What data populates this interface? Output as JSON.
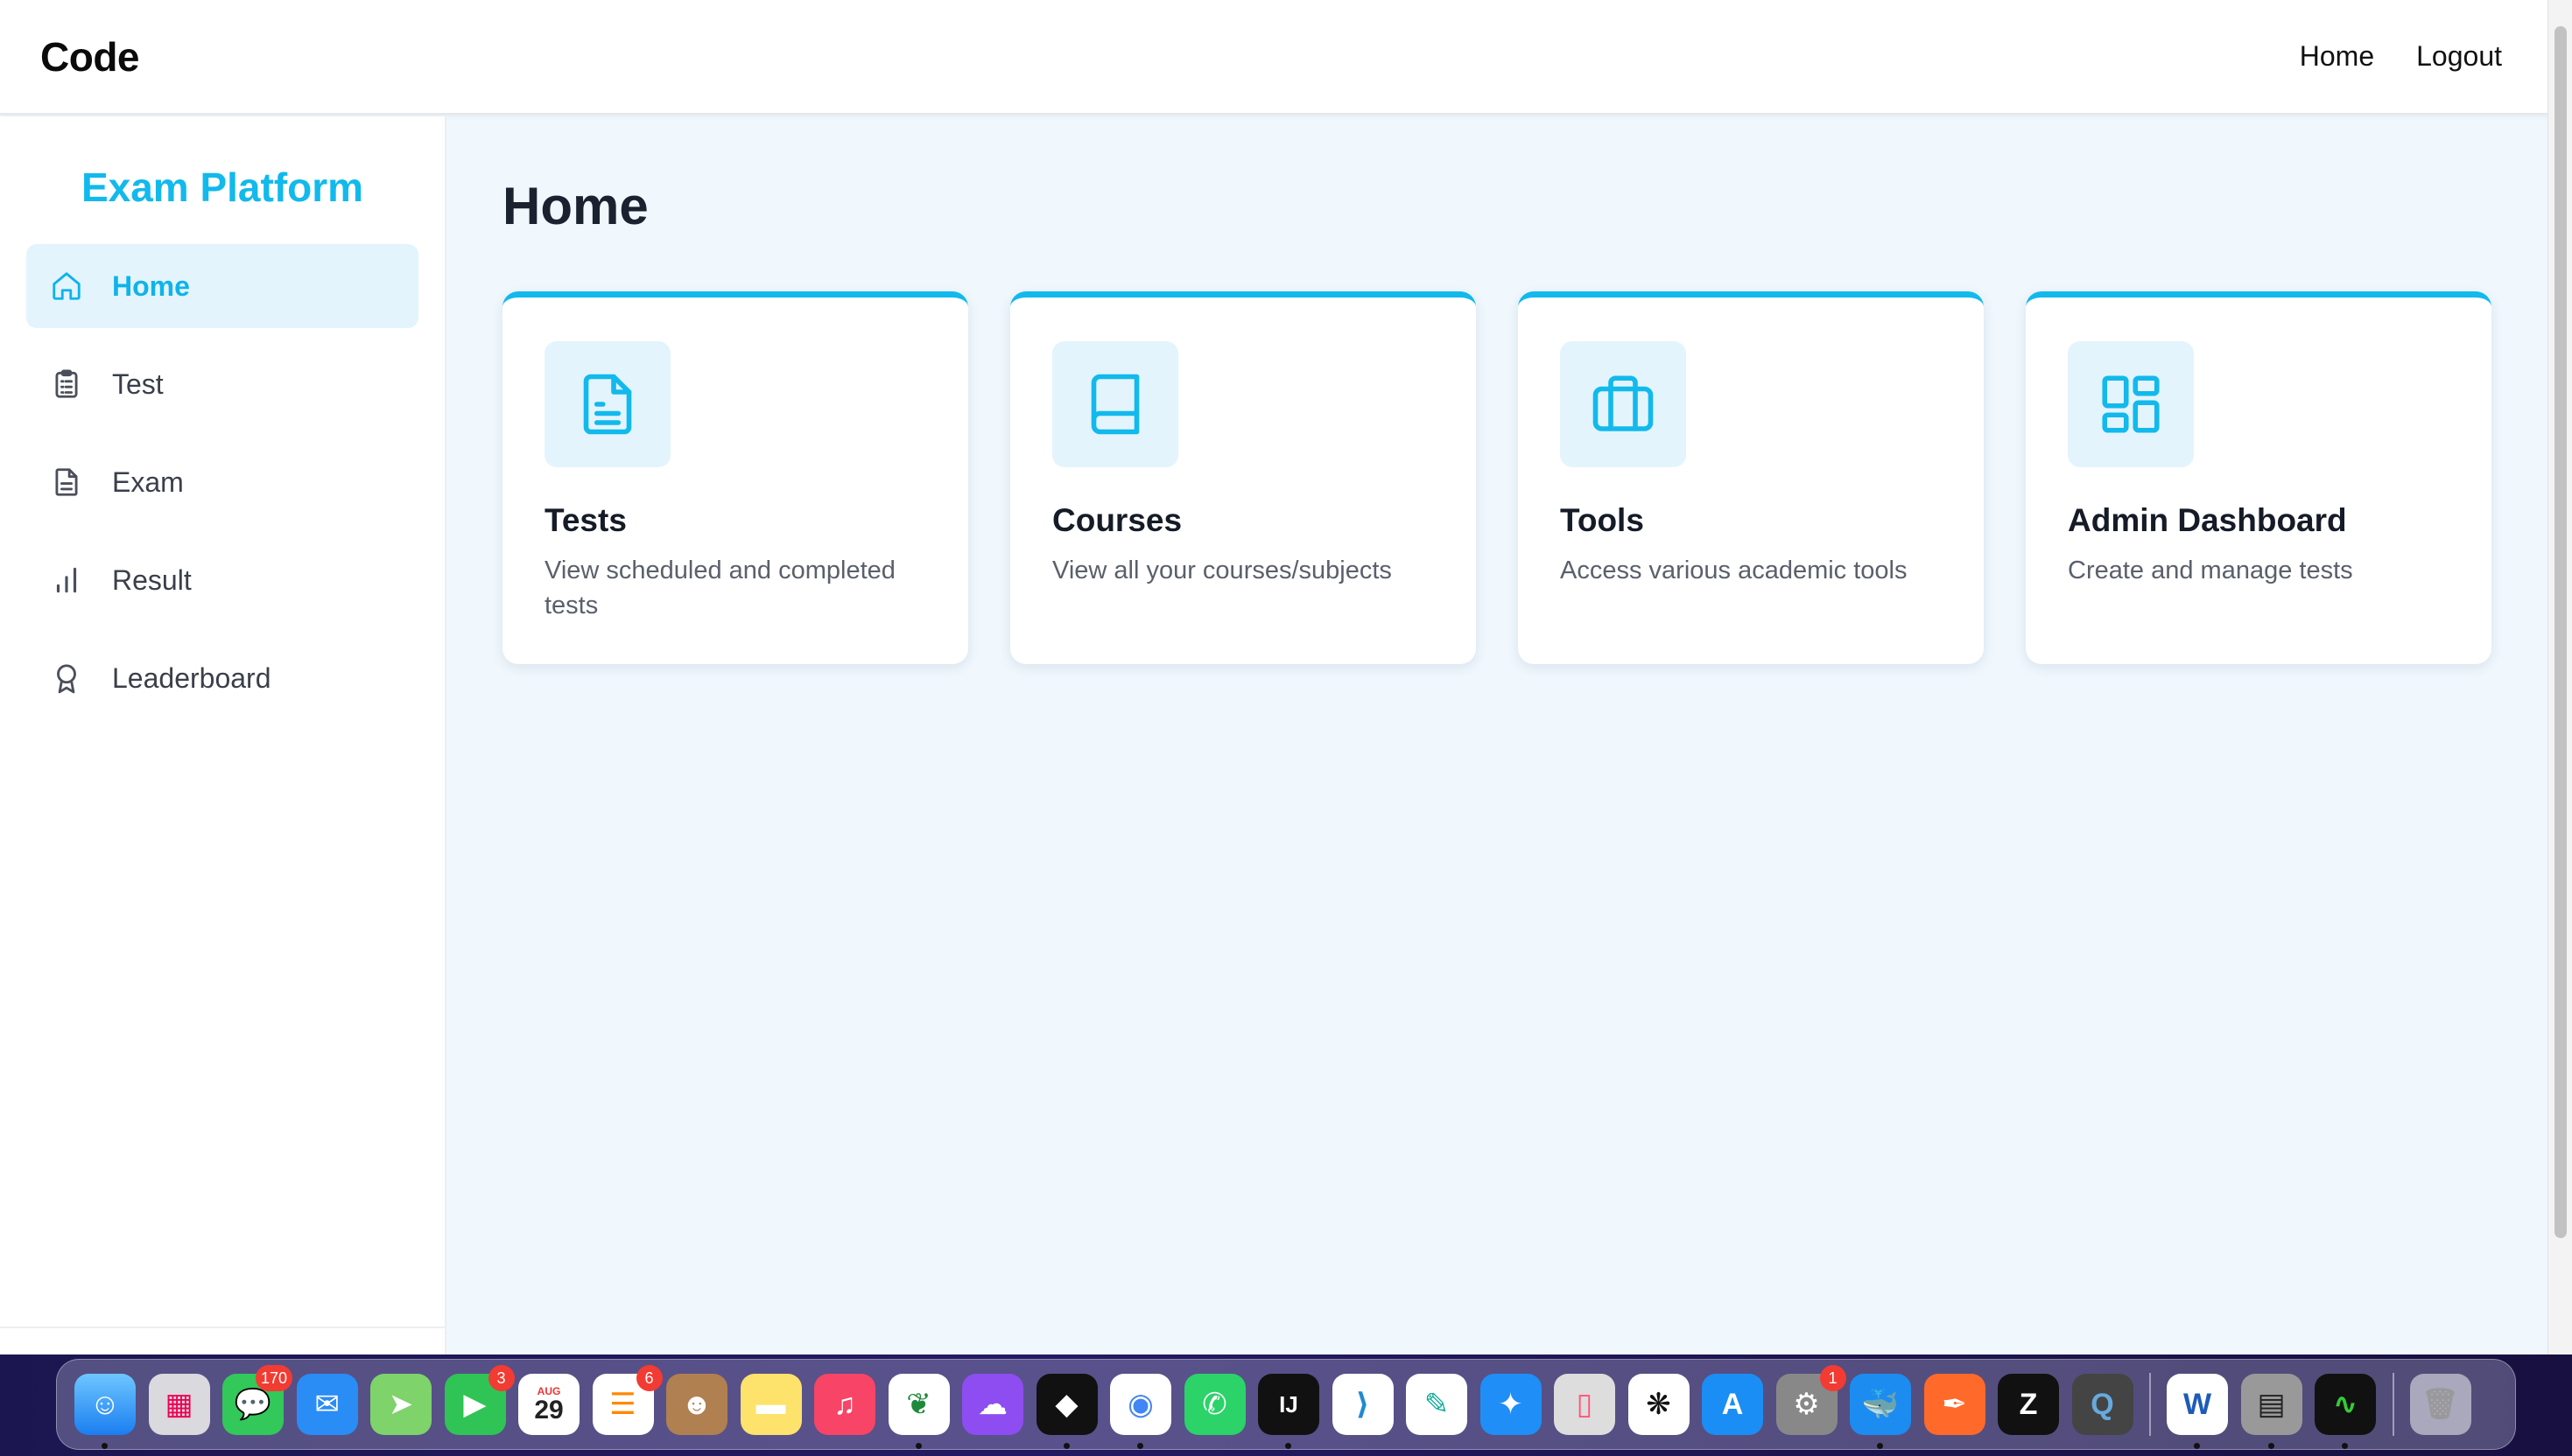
{
  "navbar": {
    "brand": "Code",
    "links": [
      "Home",
      "Logout"
    ]
  },
  "sidebar": {
    "title": "Exam Platform",
    "items": [
      {
        "label": "Home",
        "icon": "home-icon",
        "active": true
      },
      {
        "label": "Test",
        "icon": "clipboard-icon",
        "active": false
      },
      {
        "label": "Exam",
        "icon": "document-icon",
        "active": false
      },
      {
        "label": "Result",
        "icon": "bar-chart-icon",
        "active": false
      },
      {
        "label": "Leaderboard",
        "icon": "award-icon",
        "active": false
      }
    ]
  },
  "main": {
    "title": "Home",
    "cards": [
      {
        "title": "Tests",
        "desc": "View scheduled and completed tests",
        "icon": "document-icon"
      },
      {
        "title": "Courses",
        "desc": "View all your courses/subjects",
        "icon": "book-icon"
      },
      {
        "title": "Tools",
        "desc": "Access various academic tools",
        "icon": "briefcase-icon"
      },
      {
        "title": "Admin Dashboard",
        "desc": "Create and manage tests",
        "icon": "dashboard-icon"
      }
    ]
  },
  "dock": {
    "calendar_month": "AUG",
    "calendar_day": "29",
    "badges": {
      "messages": "170",
      "facetime": "3",
      "reminders": "6",
      "settings": "1"
    }
  },
  "colors": {
    "accent": "#12b9ec",
    "accent_light": "#e3f4fd",
    "main_bg": "#f0f8fe"
  }
}
